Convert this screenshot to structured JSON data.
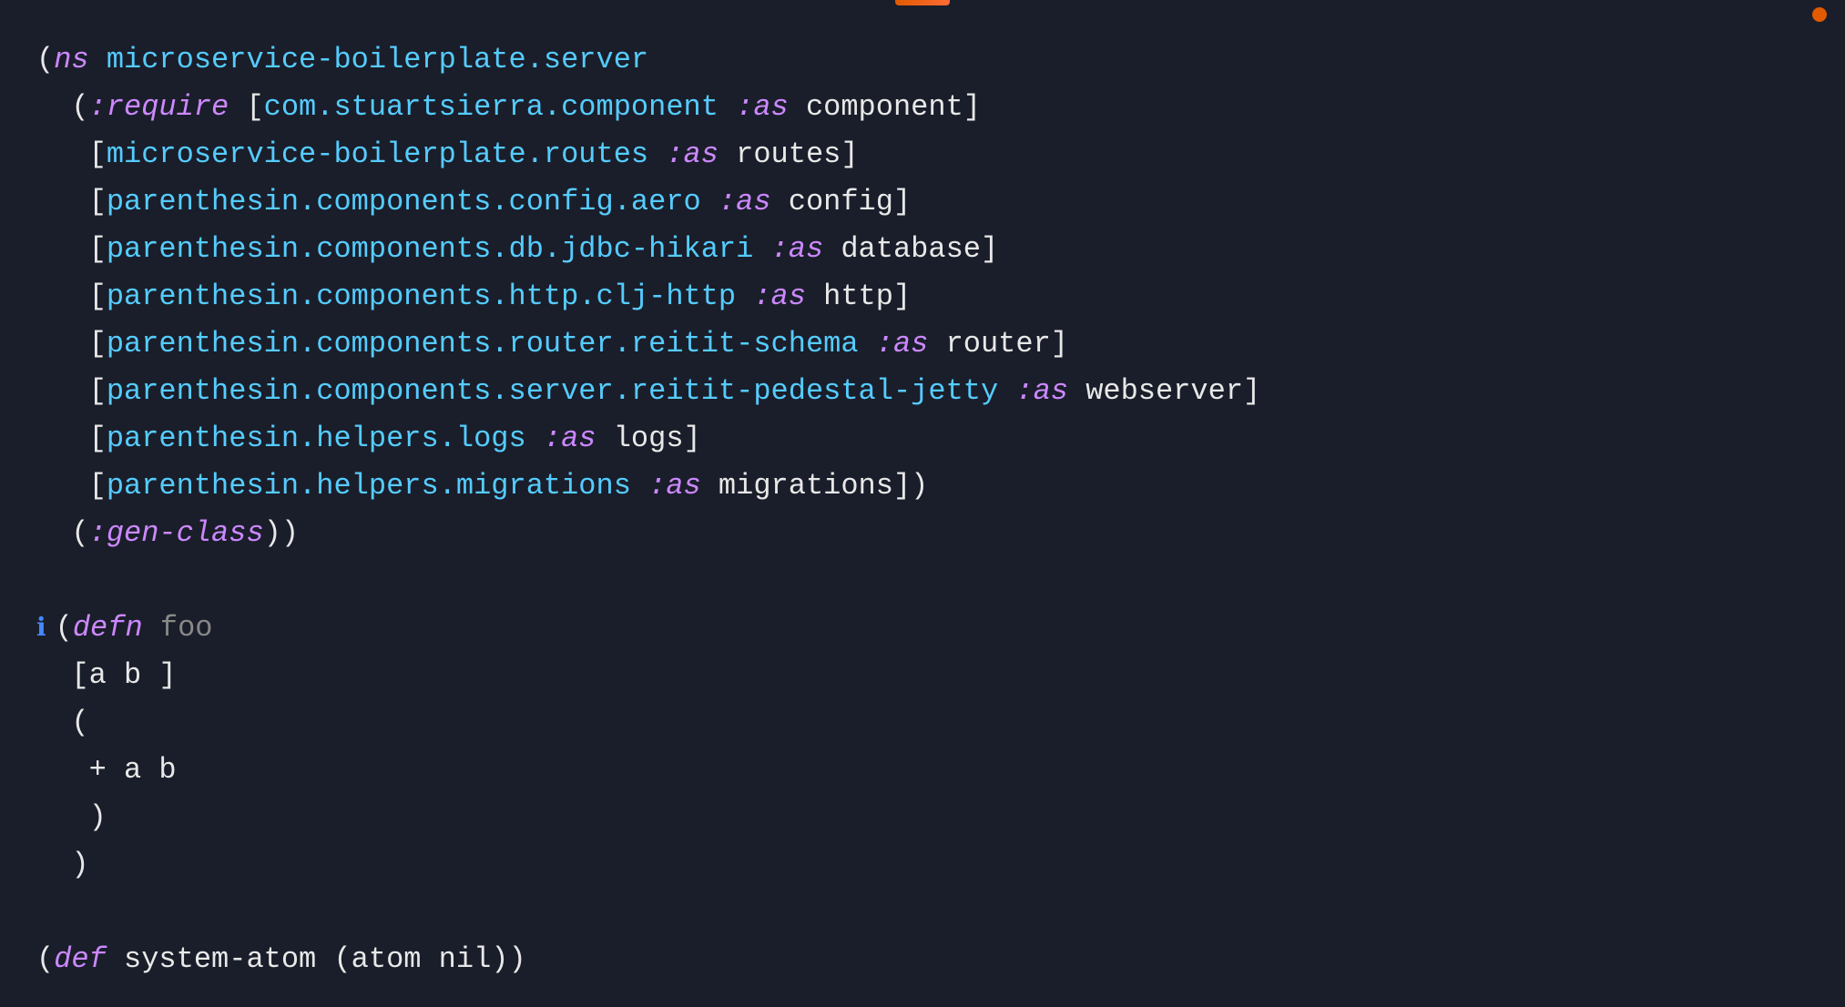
{
  "editor": {
    "background": "#1a1e2a",
    "code": {
      "line1": "(ns microservice-boilerplate.server",
      "line2_p1": "  (:require [com.stuartsierra.component ",
      "line2_as": ":as",
      "line2_p2": " component]",
      "line3_p1": "   [microservice-boilerplate.routes ",
      "line3_as": ":as",
      "line3_p2": " routes]",
      "line4_p1": "   [parenthesin.components.config.aero ",
      "line4_as": ":as",
      "line4_p2": " config]",
      "line5_p1": "   [parenthesin.components.db.jdbc-hikari ",
      "line5_as": ":as",
      "line5_p2": " database]",
      "line6_p1": "   [parenthesin.components.http.clj-http ",
      "line6_as": ":as",
      "line6_p2": " http]",
      "line7_p1": "   [parenthesin.components.router.reitit-schema ",
      "line7_as": ":as",
      "line7_p2": " router]",
      "line8_p1": "   [parenthesin.components.server.reitit-pedestal-jetty ",
      "line8_as": ":as",
      "line8_p2": " webserver]",
      "line9_p1": "   [parenthesin.helpers.logs ",
      "line9_as": ":as",
      "line9_p2": " logs]",
      "line10_p1": "   [parenthesin.helpers.migrations ",
      "line10_as": ":as",
      "line10_p2": " migrations])",
      "line11": "  (:gen-class))",
      "line12": "",
      "line13_p1": "(defn ",
      "line13_fn": "foo",
      "line14": "  [a b ]",
      "line15": "  (",
      "line16": "   + a b",
      "line17": "   )",
      "line18": "  )",
      "line19": "",
      "line20": "(def system-atom (atom nil))"
    }
  }
}
